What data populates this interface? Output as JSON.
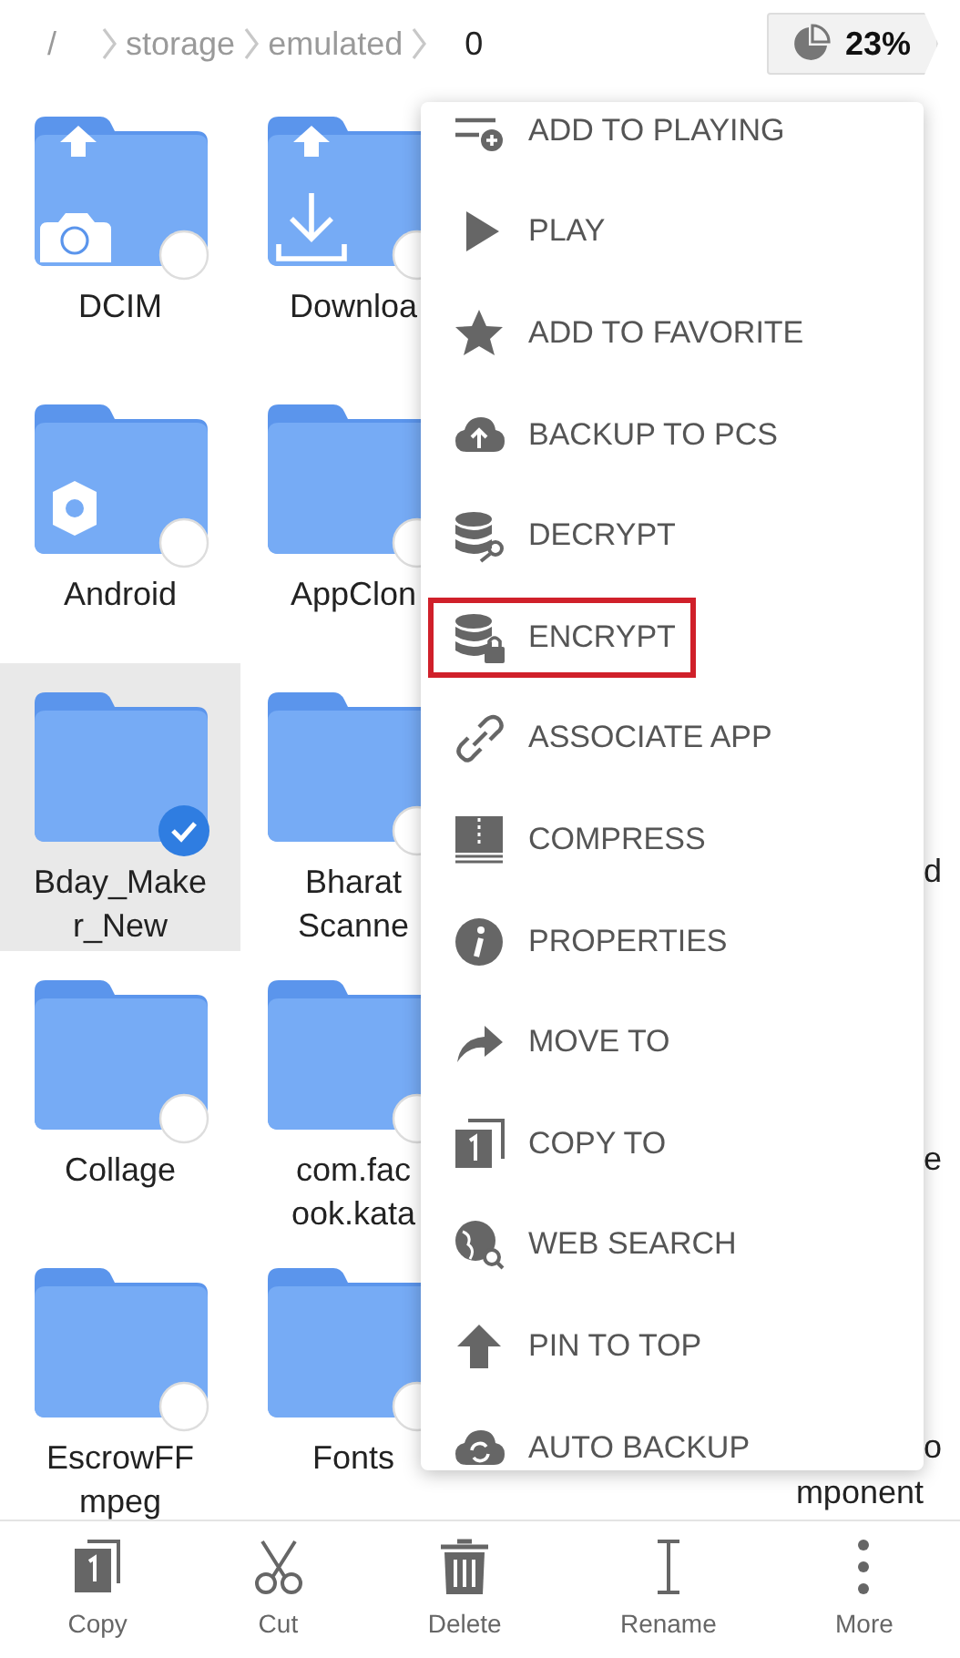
{
  "breadcrumb": [
    "/",
    "storage",
    "emulated",
    "0"
  ],
  "storage": {
    "reading": "23%"
  },
  "rows": [
    {
      "items": [
        {
          "label": [
            "DCIM"
          ],
          "kind": "camera",
          "selected": false
        },
        {
          "label": [
            "Downloa"
          ],
          "kind": "download",
          "selected": false
        }
      ]
    },
    {
      "items": [
        {
          "label": [
            "Android"
          ],
          "kind": "gear",
          "selected": false
        },
        {
          "label": [
            "AppClon"
          ],
          "selected": false
        }
      ]
    },
    {
      "items": [
        {
          "label": [
            "Bday_Make",
            "r_New"
          ],
          "selected": true
        },
        {
          "label": [
            "Bharat",
            "Scanne"
          ],
          "selected": false
        }
      ],
      "edge_text": [
        "d"
      ]
    },
    {
      "items": [
        {
          "label": [
            "Collage"
          ],
          "selected": false
        },
        {
          "label": [
            "com.fac",
            "ook.kata"
          ],
          "selected": false
        }
      ],
      "edge_text": [
        "e"
      ]
    },
    {
      "items": [
        {
          "label": [
            "EscrowFF",
            "mpeg"
          ],
          "selected": false
        },
        {
          "label": [
            "Fonts"
          ],
          "selected": false
        }
      ],
      "edge_text": [
        "o",
        "mponent"
      ]
    }
  ],
  "menu": [
    {
      "label": "ADD TO PLAYING",
      "kind": "queue",
      "highlighted": false
    },
    {
      "label": "PLAY",
      "kind": "play",
      "highlighted": false
    },
    {
      "label": "ADD TO FAVORITE",
      "kind": "star",
      "highlighted": false
    },
    {
      "label": "BACKUP TO PCS",
      "kind": "cloud-up",
      "highlighted": false
    },
    {
      "label": "DECRYPT",
      "kind": "db-key",
      "highlighted": false
    },
    {
      "label": "ENCRYPT",
      "kind": "db-lock",
      "highlighted": true
    },
    {
      "label": "ASSOCIATE APP",
      "kind": "link",
      "highlighted": false
    },
    {
      "label": "COMPRESS",
      "kind": "zip",
      "highlighted": false
    },
    {
      "label": "PROPERTIES",
      "kind": "info",
      "highlighted": false
    },
    {
      "label": "MOVE TO",
      "kind": "share",
      "highlighted": false
    },
    {
      "label": "COPY TO",
      "kind": "copy",
      "highlighted": false
    },
    {
      "label": "WEB SEARCH",
      "kind": "globe",
      "highlighted": false
    },
    {
      "label": "PIN TO TOP",
      "kind": "up",
      "highlighted": false
    },
    {
      "label": "AUTO BACKUP",
      "kind": "cloud-sync",
      "highlighted": false
    }
  ],
  "toolbar": [
    {
      "label": "Copy",
      "kind": "copy"
    },
    {
      "label": "Cut",
      "kind": "scissors"
    },
    {
      "label": "Delete",
      "kind": "trash"
    },
    {
      "label": "Rename",
      "kind": "cursor"
    },
    {
      "label": "More",
      "kind": "dots"
    }
  ]
}
